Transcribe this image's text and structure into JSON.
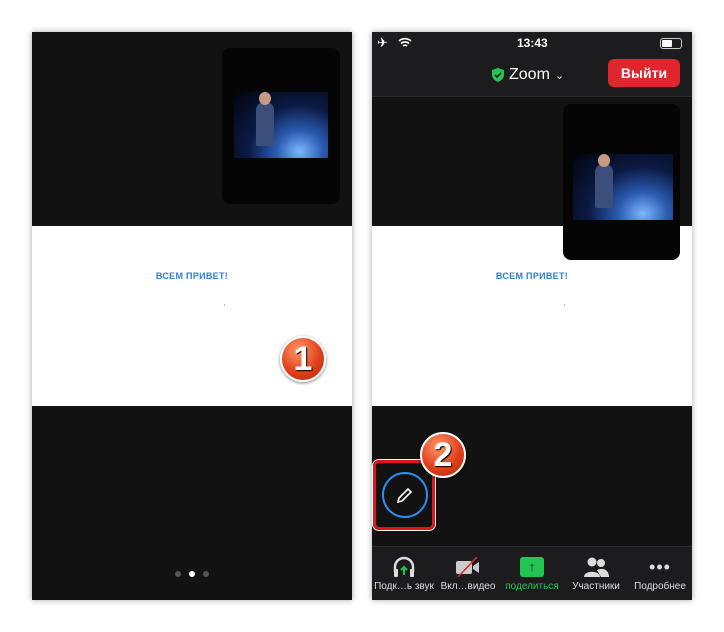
{
  "slide_text": "ВСЕМ ПРИВЕТ!",
  "badges": {
    "one": "1",
    "two": "2"
  },
  "status": {
    "time": "13:43"
  },
  "header": {
    "title": "Zoom",
    "leave_label": "Выйти"
  },
  "toolbar": [
    {
      "label": "Подк…ь звук",
      "icon": "headphones-icon"
    },
    {
      "label": "Вкл…видео",
      "icon": "video-off-icon"
    },
    {
      "label": "поделиться",
      "icon": "share-icon"
    },
    {
      "label": "Участники",
      "icon": "participants-icon"
    },
    {
      "label": "Подробнее",
      "icon": "more-icon"
    }
  ],
  "colors": {
    "accent": "#2b8ef0",
    "leave": "#e0262d",
    "share": "#23c552"
  }
}
